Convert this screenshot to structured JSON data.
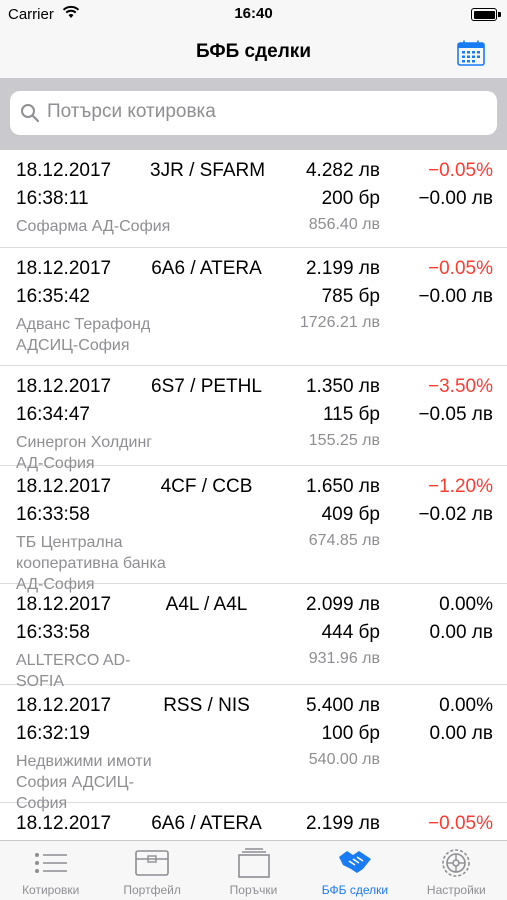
{
  "status": {
    "carrier": "Carrier",
    "time": "16:40"
  },
  "nav": {
    "title": "БФБ сделки",
    "calendar_icon": "calendar-icon"
  },
  "search": {
    "placeholder": "Потърси котировка"
  },
  "colors": {
    "negative": "#ff3b30",
    "accent": "#1a7cf5",
    "secondary_text": "#8e8e93"
  },
  "trades": [
    {
      "date": "18.12.2017",
      "time": "16:38:11",
      "code": "3JR / SFARM",
      "price": "4.282 лв",
      "qty": "200 бр",
      "total": "856.40 лв",
      "change_pct": "−0.05%",
      "change_val": "−0.00 лв",
      "name": "Софарма АД-София",
      "negative": true
    },
    {
      "date": "18.12.2017",
      "time": "16:35:42",
      "code": "6A6 / ATERA",
      "price": "2.199 лв",
      "qty": "785 бр",
      "total": "1726.21 лв",
      "change_pct": "−0.05%",
      "change_val": "−0.00 лв",
      "name": "Адванс Терафонд АДСИЦ-София",
      "negative": true
    },
    {
      "date": "18.12.2017",
      "time": "16:34:47",
      "code": "6S7 / PETHL",
      "price": "1.350 лв",
      "qty": "115 бр",
      "total": "155.25 лв",
      "change_pct": "−3.50%",
      "change_val": "−0.05 лв",
      "name": "Синергон Холдинг АД-София",
      "negative": true
    },
    {
      "date": "18.12.2017",
      "time": "16:33:58",
      "code": "4CF / CCB",
      "price": "1.650 лв",
      "qty": "409 бр",
      "total": "674.85 лв",
      "change_pct": "−1.20%",
      "change_val": "−0.02 лв",
      "name": "ТБ Централна кооперативна банка АД-София",
      "negative": true
    },
    {
      "date": "18.12.2017",
      "time": "16:33:58",
      "code": "A4L / A4L",
      "price": "2.099 лв",
      "qty": "444 бр",
      "total": "931.96 лв",
      "change_pct": "0.00%",
      "change_val": "0.00 лв",
      "name": "ALLTERCO AD-SOFIA",
      "negative": false
    },
    {
      "date": "18.12.2017",
      "time": "16:32:19",
      "code": "RSS / NIS",
      "price": "5.400 лв",
      "qty": "100 бр",
      "total": "540.00 лв",
      "change_pct": "0.00%",
      "change_val": "0.00 лв",
      "name": "Недвижими имоти София АДСИЦ-София",
      "negative": false
    },
    {
      "date": "18.12.2017",
      "time": "",
      "code": "6A6 / ATERA",
      "price": "2.199 лв",
      "qty": "",
      "total": "",
      "change_pct": "−0.05%",
      "change_val": "",
      "name": "",
      "negative": true
    }
  ],
  "tabs": [
    {
      "label": "Котировки",
      "icon": "list-icon",
      "active": false
    },
    {
      "label": "Портфейл",
      "icon": "portfolio-icon",
      "active": false
    },
    {
      "label": "Поръчки",
      "icon": "orders-icon",
      "active": false
    },
    {
      "label": "БФБ сделки",
      "icon": "handshake-icon",
      "active": true
    },
    {
      "label": "Настройки",
      "icon": "settings-gear-icon",
      "active": false
    }
  ]
}
